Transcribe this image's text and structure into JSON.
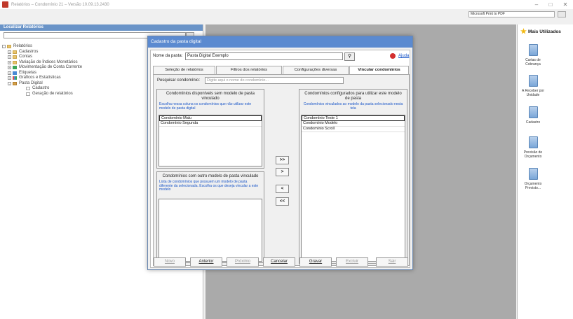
{
  "window": {
    "title": "Relatórios – Condomínio 21 – Versão 10.09.13.2430",
    "minimize": "–",
    "maximize": "□",
    "close": "✕"
  },
  "printer": {
    "selected": "Microsoft Print to PDF"
  },
  "left_panel": {
    "header": "Localizar Relatórios",
    "tree": [
      {
        "label": "Relatórios",
        "level": 0,
        "icon": "folder-icon"
      },
      {
        "label": "Cadastros",
        "level": 1,
        "icon": "folder-icon"
      },
      {
        "label": "Contas",
        "level": 1,
        "icon": "folder-icon"
      },
      {
        "label": "Variação de Índices Monetários",
        "level": 1,
        "icon": "folder-icon"
      },
      {
        "label": "Movimentação de Conta Corrente",
        "level": 1,
        "icon": "folder-icon"
      },
      {
        "label": "Etiquetas",
        "level": 1,
        "icon": "folder-icon"
      },
      {
        "label": "Gráficos e Estatísticas",
        "level": 1,
        "icon": "chart-icon"
      },
      {
        "label": "Pasta Digital",
        "level": 1,
        "icon": "folder-icon"
      },
      {
        "label": "Cadastro",
        "level": 2,
        "icon": "page-icon"
      },
      {
        "label": "Geração de relatórios",
        "level": 2,
        "icon": "page-icon"
      }
    ]
  },
  "right_panel": {
    "header": "Mais Utilizados",
    "items": [
      "Cartas de Cobrança",
      "A Receber por Unidade",
      "Cadastro",
      "Previsão de Orçamento",
      "Orçamento Previsto..."
    ]
  },
  "dialog": {
    "title": "Cadastro da pasta digital",
    "folder_name_label": "Nome da pasta:",
    "folder_name_value": "Pasta Digital Exemplo",
    "help": "Ajuda",
    "tabs": [
      "Seleção de relatórios",
      "Filtros dos relatórios",
      "Configurações diversas",
      "Vincular condomínios"
    ],
    "search_label": "Pesquisar condomínio:",
    "search_placeholder": "Digite aqui o nome do condomínio...",
    "available": {
      "title": "Condomínios disponíveis sem modelo de pasta vinculado",
      "desc": "Escolha nessa coluna os condomínios que não utilizar este modelo de pasta digital",
      "items": [
        "Condomínio Malu",
        "Condomínio Segunda"
      ]
    },
    "other_model": {
      "title": "Condomínios com outro modelo de pasta vinculado",
      "desc": "Lista de condomínios que possuem um modelo de pasta diferente da selecionada. Escolha os que deseja vincular a este modelo",
      "items": []
    },
    "configured": {
      "title": "Condomínios configurados para utilizar este modelo de pasta",
      "desc": "Condomínios vinculados ao modelo da pasta selecionado nesta tela",
      "items": [
        "Condomínio Teste 1",
        "Condomínio Modelo",
        "Condomínio Scroll"
      ]
    },
    "buttons_move": {
      "all_right": ">>",
      "right": ">",
      "left": "<",
      "all_left": "<<"
    },
    "bottom_buttons": {
      "new": "Novo",
      "previous": "Anterior",
      "next": "Próximo",
      "cancel": "Cancelar",
      "save": "Gravar",
      "delete": "Excluir",
      "exit": "Sair"
    }
  }
}
